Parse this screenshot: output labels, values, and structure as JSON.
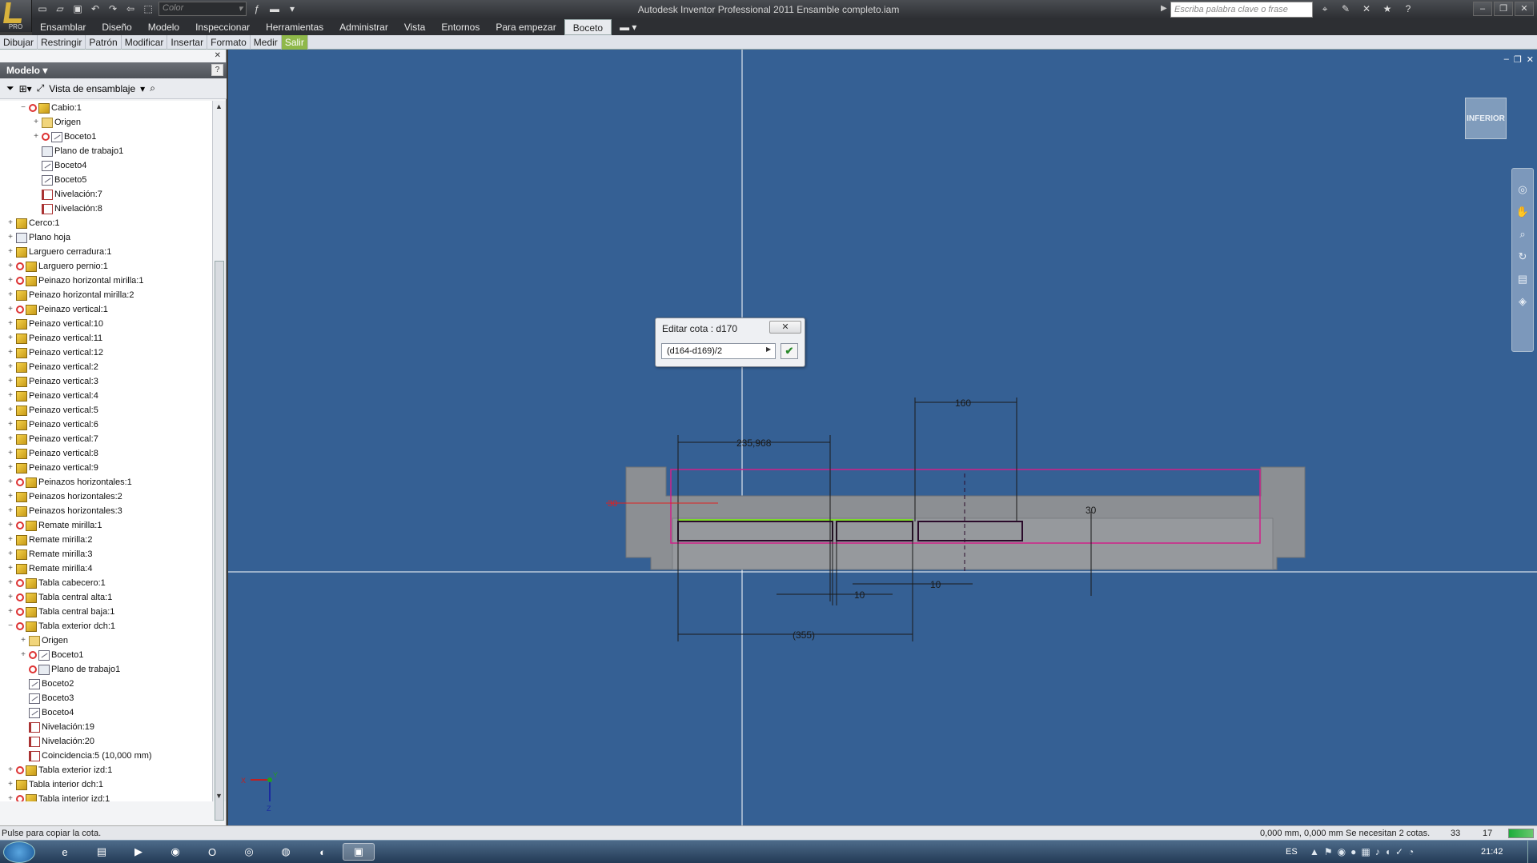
{
  "titlebar": {
    "title": "Autodesk Inventor Professional 2011    Ensamble completo.iam",
    "color_combo": "Color",
    "search_placeholder": "Escriba palabra clave o frase",
    "app_badge": "PRO"
  },
  "menubar": {
    "items": [
      "Ensamblar",
      "Diseño",
      "Modelo",
      "Inspeccionar",
      "Herramientas",
      "Administrar",
      "Vista",
      "Entornos",
      "Para empezar",
      "Boceto"
    ],
    "active": "Boceto"
  },
  "subbar": {
    "items": [
      "Dibujar",
      "Restringir",
      "Patrón",
      "Modificar",
      "Insertar",
      "Formato",
      "Medir"
    ],
    "exit": "Salir"
  },
  "panel": {
    "title": "Modelo",
    "help": "?",
    "view_label": "Vista de ensamblaje",
    "tree": [
      {
        "label": "Cabio:1",
        "level": 1,
        "exp": "−",
        "icon": "part",
        "update": true
      },
      {
        "label": "Origen",
        "level": 2,
        "exp": "+",
        "icon": "folder",
        "update": false
      },
      {
        "label": "Boceto1",
        "level": 2,
        "exp": "+",
        "icon": "sketch",
        "update": true
      },
      {
        "label": "Plano de trabajo1",
        "level": 2,
        "exp": "",
        "icon": "plane",
        "update": false
      },
      {
        "label": "Boceto4",
        "level": 2,
        "exp": "",
        "icon": "sketch",
        "update": false
      },
      {
        "label": "Boceto5",
        "level": 2,
        "exp": "",
        "icon": "sketch",
        "update": false
      },
      {
        "label": "Nivelación:7",
        "level": 2,
        "exp": "",
        "icon": "constraint",
        "update": false
      },
      {
        "label": "Nivelación:8",
        "level": 2,
        "exp": "",
        "icon": "constraint",
        "update": false
      },
      {
        "label": "Cerco:1",
        "level": 0,
        "exp": "+",
        "icon": "part",
        "update": false
      },
      {
        "label": "Plano hoja",
        "level": 0,
        "exp": "+",
        "icon": "plane",
        "update": false
      },
      {
        "label": "Larguero cerradura:1",
        "level": 0,
        "exp": "+",
        "icon": "part",
        "update": false
      },
      {
        "label": "Larguero pernio:1",
        "level": 0,
        "exp": "+",
        "icon": "part",
        "update": true
      },
      {
        "label": "Peinazo horizontal mirilla:1",
        "level": 0,
        "exp": "+",
        "icon": "part",
        "update": true
      },
      {
        "label": "Peinazo horizontal mirilla:2",
        "level": 0,
        "exp": "+",
        "icon": "part",
        "update": false
      },
      {
        "label": "Peinazo vertical:1",
        "level": 0,
        "exp": "+",
        "icon": "part",
        "update": true
      },
      {
        "label": "Peinazo vertical:10",
        "level": 0,
        "exp": "+",
        "icon": "part",
        "update": false
      },
      {
        "label": "Peinazo vertical:11",
        "level": 0,
        "exp": "+",
        "icon": "part",
        "update": false
      },
      {
        "label": "Peinazo vertical:12",
        "level": 0,
        "exp": "+",
        "icon": "part",
        "update": false
      },
      {
        "label": "Peinazo vertical:2",
        "level": 0,
        "exp": "+",
        "icon": "part",
        "update": false
      },
      {
        "label": "Peinazo vertical:3",
        "level": 0,
        "exp": "+",
        "icon": "part",
        "update": false
      },
      {
        "label": "Peinazo vertical:4",
        "level": 0,
        "exp": "+",
        "icon": "part",
        "update": false
      },
      {
        "label": "Peinazo vertical:5",
        "level": 0,
        "exp": "+",
        "icon": "part",
        "update": false
      },
      {
        "label": "Peinazo vertical:6",
        "level": 0,
        "exp": "+",
        "icon": "part",
        "update": false
      },
      {
        "label": "Peinazo vertical:7",
        "level": 0,
        "exp": "+",
        "icon": "part",
        "update": false
      },
      {
        "label": "Peinazo vertical:8",
        "level": 0,
        "exp": "+",
        "icon": "part",
        "update": false
      },
      {
        "label": "Peinazo vertical:9",
        "level": 0,
        "exp": "+",
        "icon": "part",
        "update": false
      },
      {
        "label": "Peinazos horizontales:1",
        "level": 0,
        "exp": "+",
        "icon": "part",
        "update": true
      },
      {
        "label": "Peinazos horizontales:2",
        "level": 0,
        "exp": "+",
        "icon": "part",
        "update": false
      },
      {
        "label": "Peinazos horizontales:3",
        "level": 0,
        "exp": "+",
        "icon": "part",
        "update": false
      },
      {
        "label": "Remate mirilla:1",
        "level": 0,
        "exp": "+",
        "icon": "part",
        "update": true
      },
      {
        "label": "Remate mirilla:2",
        "level": 0,
        "exp": "+",
        "icon": "part",
        "update": false
      },
      {
        "label": "Remate mirilla:3",
        "level": 0,
        "exp": "+",
        "icon": "part",
        "update": false
      },
      {
        "label": "Remate mirilla:4",
        "level": 0,
        "exp": "+",
        "icon": "part",
        "update": false
      },
      {
        "label": "Tabla cabecero:1",
        "level": 0,
        "exp": "+",
        "icon": "part",
        "update": true
      },
      {
        "label": "Tabla central alta:1",
        "level": 0,
        "exp": "+",
        "icon": "part",
        "update": true
      },
      {
        "label": "Tabla central baja:1",
        "level": 0,
        "exp": "+",
        "icon": "part",
        "update": true
      },
      {
        "label": "Tabla exterior dch:1",
        "level": 0,
        "exp": "−",
        "icon": "part",
        "update": true
      },
      {
        "label": "Origen",
        "level": 1,
        "exp": "+",
        "icon": "folder",
        "update": false
      },
      {
        "label": "Boceto1",
        "level": 1,
        "exp": "+",
        "icon": "sketch",
        "update": true
      },
      {
        "label": "Plano de trabajo1",
        "level": 1,
        "exp": "",
        "icon": "plane",
        "update": true
      },
      {
        "label": "Boceto2",
        "level": 1,
        "exp": "",
        "icon": "sketch",
        "update": false
      },
      {
        "label": "Boceto3",
        "level": 1,
        "exp": "",
        "icon": "sketch",
        "update": false
      },
      {
        "label": "Boceto4",
        "level": 1,
        "exp": "",
        "icon": "sketch",
        "update": false
      },
      {
        "label": "Nivelación:19",
        "level": 1,
        "exp": "",
        "icon": "constraint",
        "update": false
      },
      {
        "label": "Nivelación:20",
        "level": 1,
        "exp": "",
        "icon": "constraint",
        "update": false
      },
      {
        "label": "Coincidencia:5 (10,000 mm)",
        "level": 1,
        "exp": "",
        "icon": "constraint",
        "update": false
      },
      {
        "label": "Tabla exterior izd:1",
        "level": 0,
        "exp": "+",
        "icon": "part",
        "update": true
      },
      {
        "label": "Tabla interior dch:1",
        "level": 0,
        "exp": "+",
        "icon": "part",
        "update": false
      },
      {
        "label": "Tabla interior izd:1",
        "level": 0,
        "exp": "+",
        "icon": "part",
        "update": true
      }
    ]
  },
  "viewport": {
    "viewcube_label": "INFERIOR",
    "dimensions": {
      "d_top_right": "160",
      "d_top_left": "235,968",
      "d_left": "30",
      "d_right_small": "30",
      "d_bottom_small_1": "10",
      "d_bottom_small_2": "10",
      "d_bottom": "(355)"
    },
    "axes": {
      "x": "X",
      "y": "Y",
      "z": "Z"
    }
  },
  "dialog": {
    "title": "Editar cota : d170",
    "value": "(d164-d169)/2"
  },
  "statusbar": {
    "message": "Pulse para copiar la cota.",
    "coords": "0,000 mm, 0,000 mm  Se necesitan 2 cotas.",
    "n1": "33",
    "n2": "17"
  },
  "taskbar": {
    "lang": "ES",
    "clock": "21:42"
  },
  "colors": {
    "viewport_bg": "#356094",
    "sketch_magenta": "#d0208a",
    "sketch_green": "#7cdc2a",
    "part_gray": "#8c8f93"
  }
}
